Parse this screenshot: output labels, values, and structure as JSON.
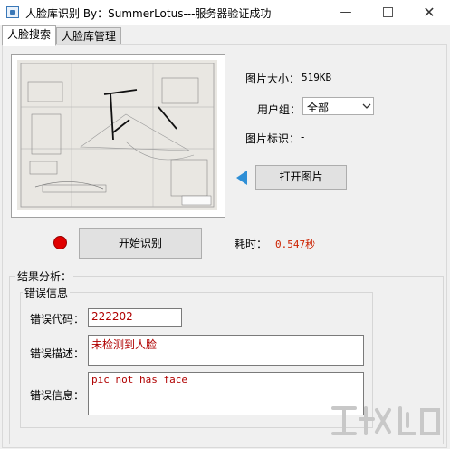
{
  "window": {
    "title": "人脸库识别 By：SummerLotus---服务器验证成功",
    "min_glyph": "—",
    "close_glyph": "✕"
  },
  "tabs": [
    {
      "label": "人脸搜索",
      "active": true
    },
    {
      "label": "人脸库管理",
      "active": false
    }
  ],
  "image_info": {
    "size_label": "图片大小：",
    "size_value": "519KB",
    "group_label": "用户组：",
    "group_value": "全部",
    "id_label": "图片标识：",
    "id_value": "-"
  },
  "buttons": {
    "open_image": "打开图片",
    "start_recognition": "开始识别"
  },
  "timing": {
    "label": "耗时：",
    "value": "0.547秒"
  },
  "results": {
    "group_title": "结果分析：",
    "error_group_title": "错误信息",
    "error_code_label": "错误代码：",
    "error_code_value": "222202",
    "error_desc_label": "错误描述：",
    "error_desc_value": "未检测到人脸",
    "error_info_label": "错误信息：",
    "error_info_value": "pic not has face"
  },
  "colors": {
    "status_indicator": "#e00000",
    "arrow_indicator": "#2f8fd6",
    "error_text": "#b00000",
    "value_text": "#cc2200"
  },
  "icons": [
    "app-icon",
    "minimize-icon",
    "maximize-icon",
    "close-icon",
    "chevron-down-icon",
    "arrow-left-icon",
    "status-dot-icon"
  ]
}
